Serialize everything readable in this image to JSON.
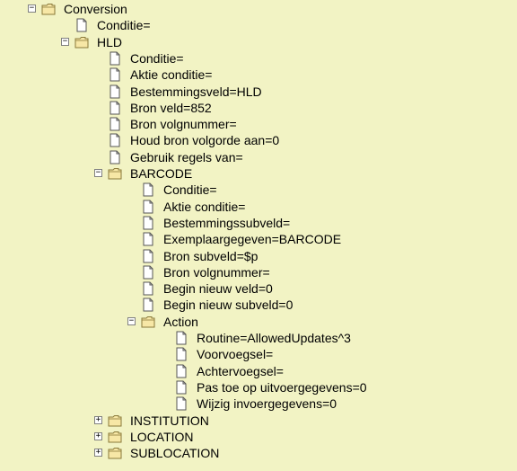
{
  "tree": {
    "root": {
      "label": "Conversion",
      "children": [
        {
          "type": "leaf",
          "label": "Conditie="
        },
        {
          "type": "folder",
          "label": "HLD",
          "expanded": true,
          "children": [
            {
              "type": "leaf",
              "label": "Conditie="
            },
            {
              "type": "leaf",
              "label": "Aktie conditie="
            },
            {
              "type": "leaf",
              "label": "Bestemmingsveld=HLD"
            },
            {
              "type": "leaf",
              "label": "Bron veld=852"
            },
            {
              "type": "leaf",
              "label": "Bron volgnummer="
            },
            {
              "type": "leaf",
              "label": "Houd bron volgorde aan=0"
            },
            {
              "type": "leaf",
              "label": "Gebruik regels van="
            },
            {
              "type": "folder",
              "label": "BARCODE",
              "expanded": true,
              "children": [
                {
                  "type": "leaf",
                  "label": "Conditie="
                },
                {
                  "type": "leaf",
                  "label": "Aktie conditie="
                },
                {
                  "type": "leaf",
                  "label": "Bestemmingssubveld="
                },
                {
                  "type": "leaf",
                  "label": "Exemplaargegeven=BARCODE"
                },
                {
                  "type": "leaf",
                  "label": "Bron subveld=$p"
                },
                {
                  "type": "leaf",
                  "label": "Bron volgnummer="
                },
                {
                  "type": "leaf",
                  "label": "Begin nieuw veld=0"
                },
                {
                  "type": "leaf",
                  "label": "Begin nieuw subveld=0"
                },
                {
                  "type": "folder",
                  "label": "Action",
                  "expanded": true,
                  "children": [
                    {
                      "type": "leaf",
                      "label": "Routine=AllowedUpdates^3"
                    },
                    {
                      "type": "leaf",
                      "label": "Voorvoegsel="
                    },
                    {
                      "type": "leaf",
                      "label": "Achtervoegsel="
                    },
                    {
                      "type": "leaf",
                      "label": "Pas toe op uitvoergegevens=0"
                    },
                    {
                      "type": "leaf",
                      "label": "Wijzig invoergegevens=0"
                    }
                  ]
                }
              ]
            },
            {
              "type": "folder",
              "label": "INSTITUTION",
              "expanded": false,
              "children": []
            },
            {
              "type": "folder",
              "label": "LOCATION",
              "expanded": false,
              "children": []
            },
            {
              "type": "folder",
              "label": "SUBLOCATION",
              "expanded": false,
              "children": []
            }
          ]
        }
      ]
    },
    "colors": {
      "background": "#f2f3c4",
      "folder_fill": "#f7e7a6",
      "folder_stroke": "#8a7a3a",
      "doc_fill": "#ffffff",
      "doc_stroke": "#555555"
    },
    "icons": {
      "folder": "folder-icon",
      "leaf": "document-icon",
      "expanded_toggle": "collapse-toggle-icon",
      "collapsed_toggle": "expand-toggle-icon"
    }
  }
}
